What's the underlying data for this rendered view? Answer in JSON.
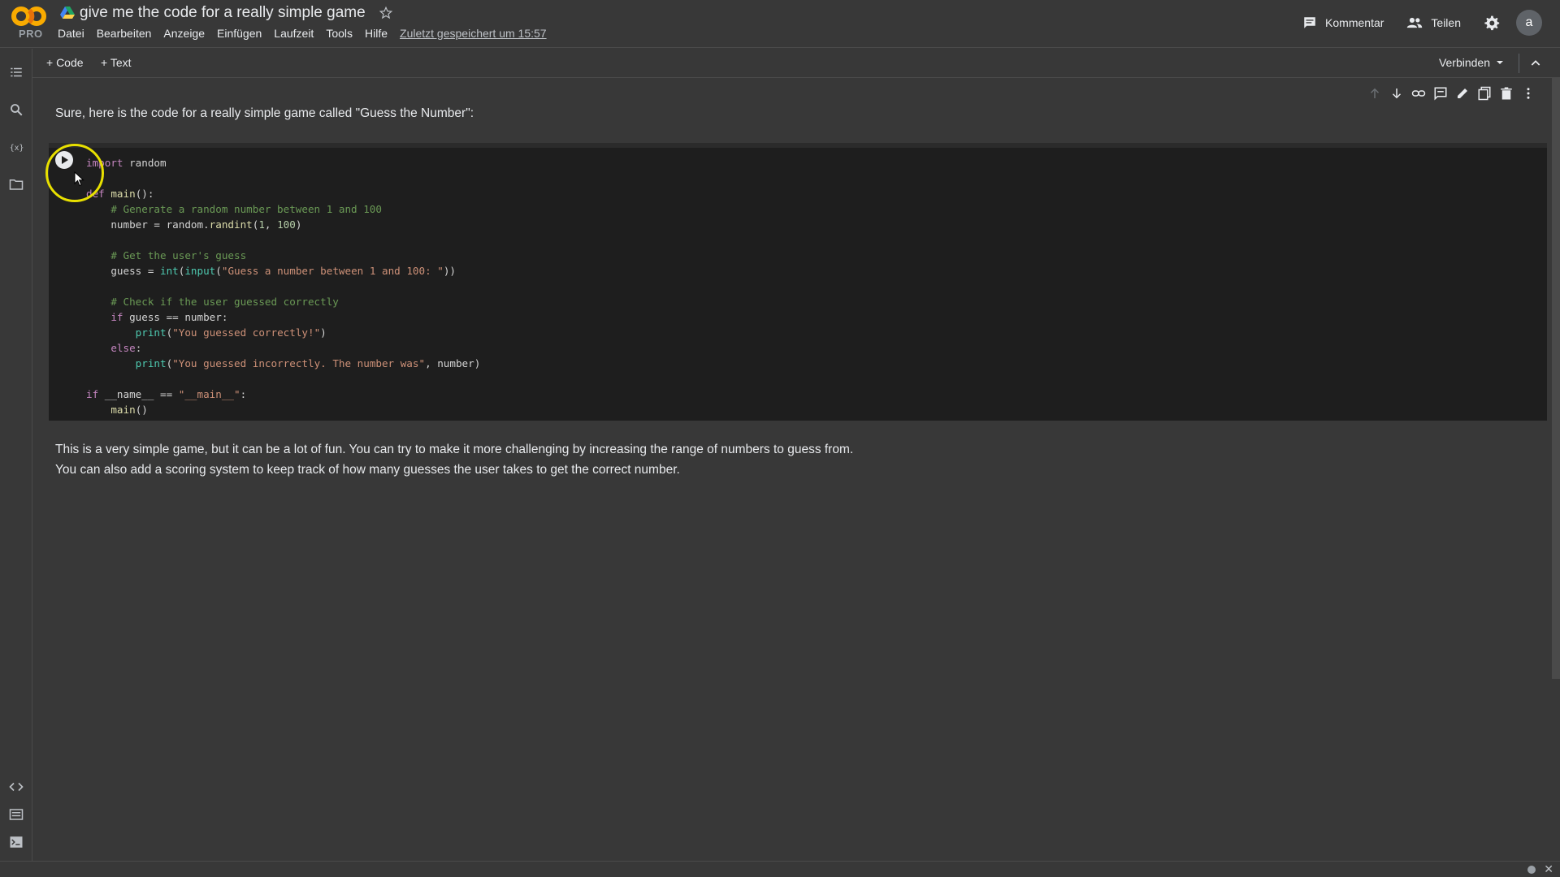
{
  "header": {
    "logo_badge": "PRO",
    "notebook_title": "give me the code for a really simple game",
    "menu": [
      "Datei",
      "Bearbeiten",
      "Anzeige",
      "Einfügen",
      "Laufzeit",
      "Tools",
      "Hilfe"
    ],
    "last_saved": "Zuletzt gespeichert um 15:57",
    "comment_label": "Kommentar",
    "share_label": "Teilen",
    "avatar_letter": "a"
  },
  "toolbar": {
    "add_code": "+ Code",
    "add_text": "+ Text",
    "connect": "Verbinden"
  },
  "cells": {
    "intro_text": "Sure, here is the code for a really simple game called \"Guess the Number\":",
    "outro_line1": "This is a very simple game, but it can be a lot of fun. You can try to make it more challenging by increasing the range of numbers to guess from.",
    "outro_line2": "You can also add a scoring system to keep track of how many guesses the user takes to get the correct number."
  },
  "code": {
    "language": "python",
    "lines": [
      "import random",
      "",
      "def main():",
      "    # Generate a random number between 1 and 100",
      "    number = random.randint(1, 100)",
      "",
      "    # Get the user's guess",
      "    guess = int(input(\"Guess a number between 1 and 100: \"))",
      "",
      "    # Check if the user guessed correctly",
      "    if guess == number:",
      "        print(\"You guessed correctly!\")",
      "    else:",
      "        print(\"You guessed incorrectly. The number was\", number)",
      "",
      "if __name__ == \"__main__\":",
      "    main()"
    ]
  },
  "icons": {
    "rail": [
      "toc-icon",
      "search-icon",
      "variables-icon",
      "folder-icon",
      "code-snippets-icon",
      "command-palette-icon",
      "terminal-icon"
    ],
    "cell_toolbar": [
      "move-up-icon",
      "move-down-icon",
      "link-icon",
      "comment-icon",
      "edit-icon",
      "mirror-cell-icon",
      "delete-icon",
      "more-icon"
    ]
  },
  "colors": {
    "background": "#383838",
    "code_background": "#1e1e1e",
    "cursor_highlight": "#e8e000",
    "logo_orange": "#f9ab00"
  }
}
